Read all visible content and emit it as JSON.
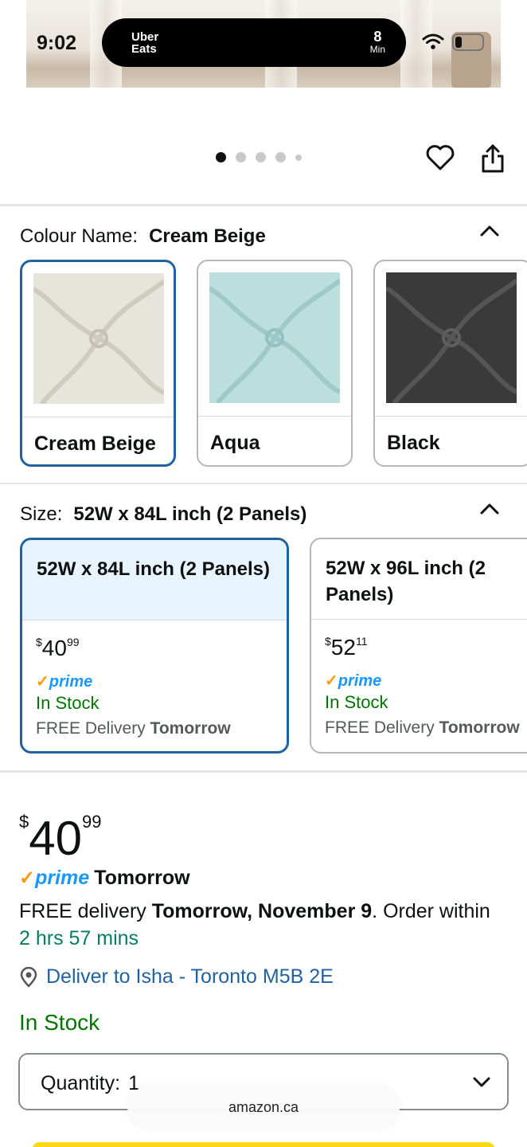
{
  "status_bar": {
    "time": "9:02",
    "live_activity": {
      "brand_line1": "Uber",
      "brand_line2": "Eats",
      "minutes": "8",
      "minutes_unit": "Min"
    }
  },
  "gallery": {
    "image_count": 5,
    "active_index": 0
  },
  "colour": {
    "label": "Colour Name:",
    "selected": "Cream Beige",
    "options": [
      {
        "name": "Cream Beige",
        "swatch_color": "#e6e4db",
        "selected": true
      },
      {
        "name": "Aqua",
        "swatch_color": "#bcdedd",
        "selected": false
      },
      {
        "name": "Black",
        "swatch_color": "#3a3a3a",
        "selected": false
      }
    ]
  },
  "size": {
    "label": "Size:",
    "selected": "52W x 84L inch (2 Panels)",
    "options": [
      {
        "name": "52W x 84L inch (2 Panels)",
        "price_symbol": "$",
        "price_whole": "40",
        "price_cents": "99",
        "prime": "prime",
        "stock": "In Stock",
        "delivery_prefix": "FREE Delivery",
        "delivery_day": "Tomorrow",
        "selected": true
      },
      {
        "name": "52W x 96L inch (2 Panels)",
        "price_symbol": "$",
        "price_whole": "52",
        "price_cents": "11",
        "prime": "prime",
        "stock": "In Stock",
        "delivery_prefix": "FREE Delivery",
        "delivery_day": "Tomorrow",
        "selected": false
      }
    ]
  },
  "buybox": {
    "price_symbol": "$",
    "price_whole": "40",
    "price_cents": "99",
    "prime_word": "prime",
    "prime_label": "Tomorrow",
    "delivery_prefix": "FREE delivery ",
    "delivery_date": "Tomorrow, November 9",
    "delivery_mid": ". Order within ",
    "countdown": "2 hrs 57 mins",
    "deliver_to": "Deliver to Isha - Toronto M5B 2E",
    "stock": "In Stock",
    "quantity_label": "Quantity:",
    "quantity_value": "1"
  },
  "browser": {
    "url": "amazon.ca"
  },
  "colors": {
    "accent_blue": "#2162a1",
    "stock_green": "#007600",
    "prime_blue": "#1a98ff",
    "prime_orange": "#ff9900",
    "cta_yellow": "#ffd814"
  }
}
